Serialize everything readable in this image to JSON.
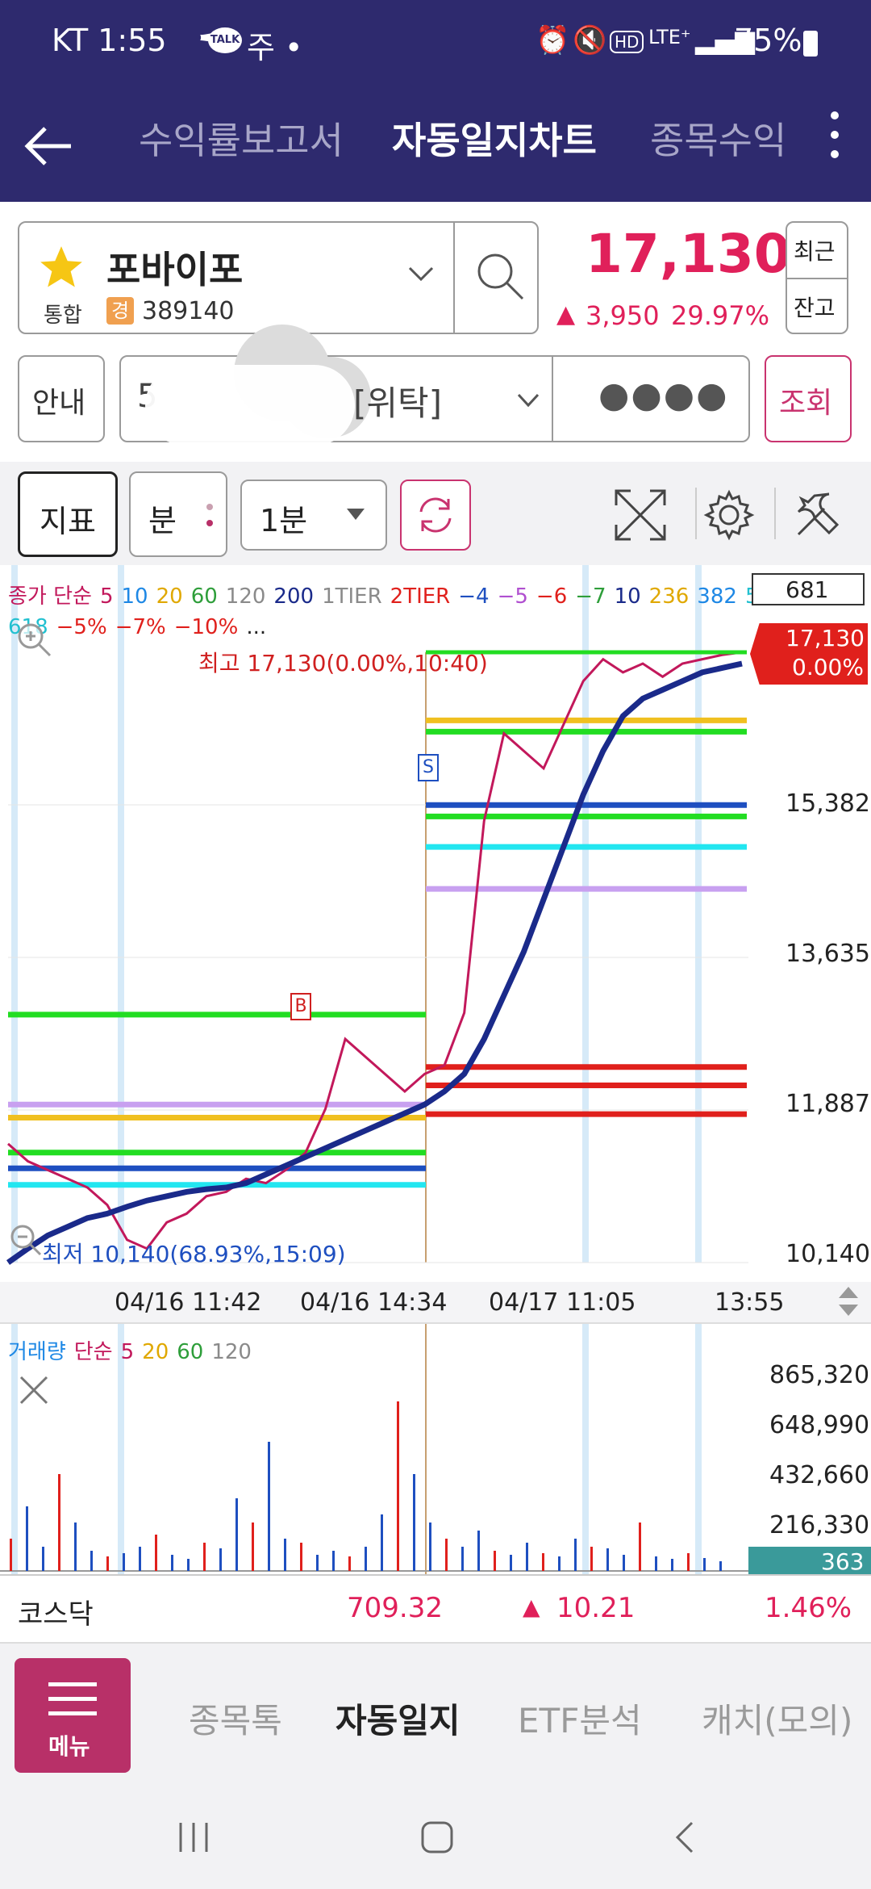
{
  "status_bar": {
    "carrier_time": "KT 1:55",
    "extra": "주 •",
    "battery": "75%"
  },
  "app_bar": {
    "tabs": [
      {
        "label": "수익률보고서",
        "active": false
      },
      {
        "label": "자동일지차트",
        "active": true
      },
      {
        "label": "종목수익",
        "active": false
      }
    ]
  },
  "stock": {
    "name": "포바이포",
    "market": "통합",
    "code_badge": "경",
    "code": "389140",
    "price": "17,130",
    "change": "3,950",
    "change_pct": "29.97%",
    "btn_recent": "최근",
    "btn_balance": "잔고"
  },
  "account_row": {
    "guide_label": "안내",
    "account_suffix": "[위탁]",
    "password_mask": "●●●●",
    "query_label": "조회"
  },
  "toolbar": {
    "indicator_label": "지표",
    "unit_label": "분",
    "interval_value": "1분"
  },
  "price_chart": {
    "legend_line1": [
      {
        "text": "종가 단순",
        "color": "#c2185b"
      },
      {
        "text": "5",
        "color": "#c2185b"
      },
      {
        "text": "10",
        "color": "#1e88e5"
      },
      {
        "text": "20",
        "color": "#e0a800"
      },
      {
        "text": "60",
        "color": "#2e9e3a"
      },
      {
        "text": "120",
        "color": "#8a8a8a"
      },
      {
        "text": "200",
        "color": "#1a2a8a"
      },
      {
        "text": "1TIER",
        "color": "#8a8a8a"
      },
      {
        "text": "2TIER",
        "color": "#e0201c"
      },
      {
        "text": "−4",
        "color": "#1e4fc0"
      },
      {
        "text": "−5",
        "color": "#b04fd0"
      },
      {
        "text": "−6",
        "color": "#e0201c"
      },
      {
        "text": "−7",
        "color": "#2e9e3a"
      },
      {
        "text": "10",
        "color": "#1a2a8a"
      },
      {
        "text": "236",
        "color": "#e0a800"
      },
      {
        "text": "382",
        "color": "#1e88e5"
      },
      {
        "text": "5",
        "color": "#22c0d0"
      }
    ],
    "legend_line2": [
      {
        "text": "618",
        "color": "#22c0d0"
      },
      {
        "text": "−5%",
        "color": "#e0201c"
      },
      {
        "text": "−7%",
        "color": "#e0201c"
      },
      {
        "text": "−10%",
        "color": "#e0201c"
      },
      {
        "text": "...",
        "color": "#222222"
      }
    ],
    "box_value": "681",
    "current_price_tag": "17,130",
    "current_pct_tag": "0.00%",
    "high_label": "최고 17,130(0.00%,10:40)",
    "low_label": "최저 10,140(68.93%,15:09)",
    "y_ticks": [
      "15,382",
      "13,635",
      "11,887",
      "10,140"
    ],
    "x_ticks": [
      "04/16 11:42",
      "04/16 14:34",
      "04/17 11:05",
      "13:55"
    ],
    "marker_buy": "B",
    "marker_sell": "S"
  },
  "chart_data": {
    "type": "line",
    "title": "",
    "ylim": [
      10140,
      17130
    ],
    "y_ticks": [
      10140,
      11887,
      13635,
      15382
    ],
    "x_ticks": [
      "04/16 11:42",
      "04/16 14:34",
      "04/17 11:05",
      "13:55"
    ],
    "series": [
      {
        "name": "종가",
        "color": "#c2185b",
        "values": [
          11500,
          11300,
          11200,
          11100,
          11000,
          10800,
          10400,
          10300,
          10600,
          10700,
          10900,
          10950,
          11100,
          11050,
          11200,
          11400,
          11900,
          12700,
          12500,
          12300,
          12100,
          12300,
          12400,
          13000,
          15200,
          16200,
          16000,
          15800,
          16300,
          16800,
          17050,
          16900,
          17000,
          16850,
          17000,
          17050,
          17100,
          17130
        ]
      },
      {
        "name": "200",
        "color": "#1a2a8a",
        "values": [
          10140,
          10300,
          10450,
          10550,
          10650,
          10700,
          10780,
          10850,
          10900,
          10950,
          10980,
          11000,
          11050,
          11150,
          11250,
          11350,
          11450,
          11550,
          11650,
          11750,
          11850,
          11950,
          12100,
          12300,
          12700,
          13200,
          13700,
          14300,
          14900,
          15500,
          16000,
          16400,
          16600,
          16700,
          16800,
          16900,
          16950,
          17000
        ]
      }
    ],
    "horizontal_levels": [
      {
        "value": 12980,
        "color": "#22dd22"
      },
      {
        "value": 11950,
        "color": "#c8a0f0"
      },
      {
        "value": 11800,
        "color": "#f0c020"
      },
      {
        "value": 11400,
        "color": "#22dd22"
      },
      {
        "value": 11220,
        "color": "#1e4fc0"
      },
      {
        "value": 11030,
        "color": "#22e6f0"
      },
      {
        "value": 16220,
        "color": "#22dd22"
      },
      {
        "value": 16350,
        "color": "#f0c020"
      },
      {
        "value": 15380,
        "color": "#1e4fc0"
      },
      {
        "value": 15250,
        "color": "#22dd22"
      },
      {
        "value": 14900,
        "color": "#22e6f0"
      },
      {
        "value": 14420,
        "color": "#c8a0f0"
      },
      {
        "value": 12380,
        "color": "#e0201c"
      },
      {
        "value": 12170,
        "color": "#e0201c"
      },
      {
        "value": 11840,
        "color": "#e0201c"
      }
    ]
  },
  "volume_chart": {
    "legend": [
      {
        "text": "거래량",
        "color": "#1e88e5"
      },
      {
        "text": "단순",
        "color": "#c2185b"
      },
      {
        "text": "5",
        "color": "#c2185b"
      },
      {
        "text": "20",
        "color": "#e0a800"
      },
      {
        "text": "60",
        "color": "#2e9e3a"
      },
      {
        "text": "120",
        "color": "#8a8a8a"
      }
    ],
    "y_ticks": [
      "865,320",
      "648,990",
      "432,660",
      "216,330"
    ],
    "current_tag": "363"
  },
  "index_bar": {
    "name": "코스닥",
    "value": "709.32",
    "change": "10.21",
    "pct": "1.46%"
  },
  "bottom_nav": {
    "menu_label": "메뉴",
    "tabs": [
      {
        "label": "종목톡",
        "active": false
      },
      {
        "label": "자동일지",
        "active": true
      },
      {
        "label": "ETF분석",
        "active": false
      },
      {
        "label": "캐치(모의)",
        "active": false
      }
    ]
  },
  "colors": {
    "header": "#2e2a6e",
    "accent": "#c9336f",
    "up": "#e0205a",
    "menu": "#b83068"
  }
}
